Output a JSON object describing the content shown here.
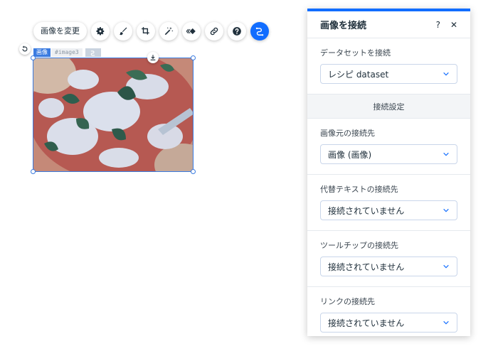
{
  "toolbar": {
    "change_image_label": "画像を変更",
    "icons": [
      "gear-icon",
      "brush-icon",
      "crop-icon",
      "magic-wand-icon",
      "animation-icon",
      "link-icon",
      "help-icon",
      "connect-data-icon"
    ],
    "active_color": "#116dff"
  },
  "element": {
    "type_tag": "画像",
    "id_tag": "#image3"
  },
  "panel": {
    "title": "画像を接続",
    "help_label": "?",
    "close_label": "✕",
    "dataset_section": {
      "label": "データセットを接続",
      "value": "レシピ dataset"
    },
    "settings_header": "接続設定",
    "image_source": {
      "label": "画像元の接続先",
      "value": "画像 (画像)"
    },
    "alt_text": {
      "label": "代替テキストの接続先",
      "value": "接続されていません"
    },
    "tooltip": {
      "label": "ツールチップの接続先",
      "value": "接続されていません"
    },
    "link": {
      "label": "リンクの接続先",
      "value": "接続されていません"
    }
  },
  "colors": {
    "accent": "#116dff",
    "selection": "#3a7be0"
  }
}
